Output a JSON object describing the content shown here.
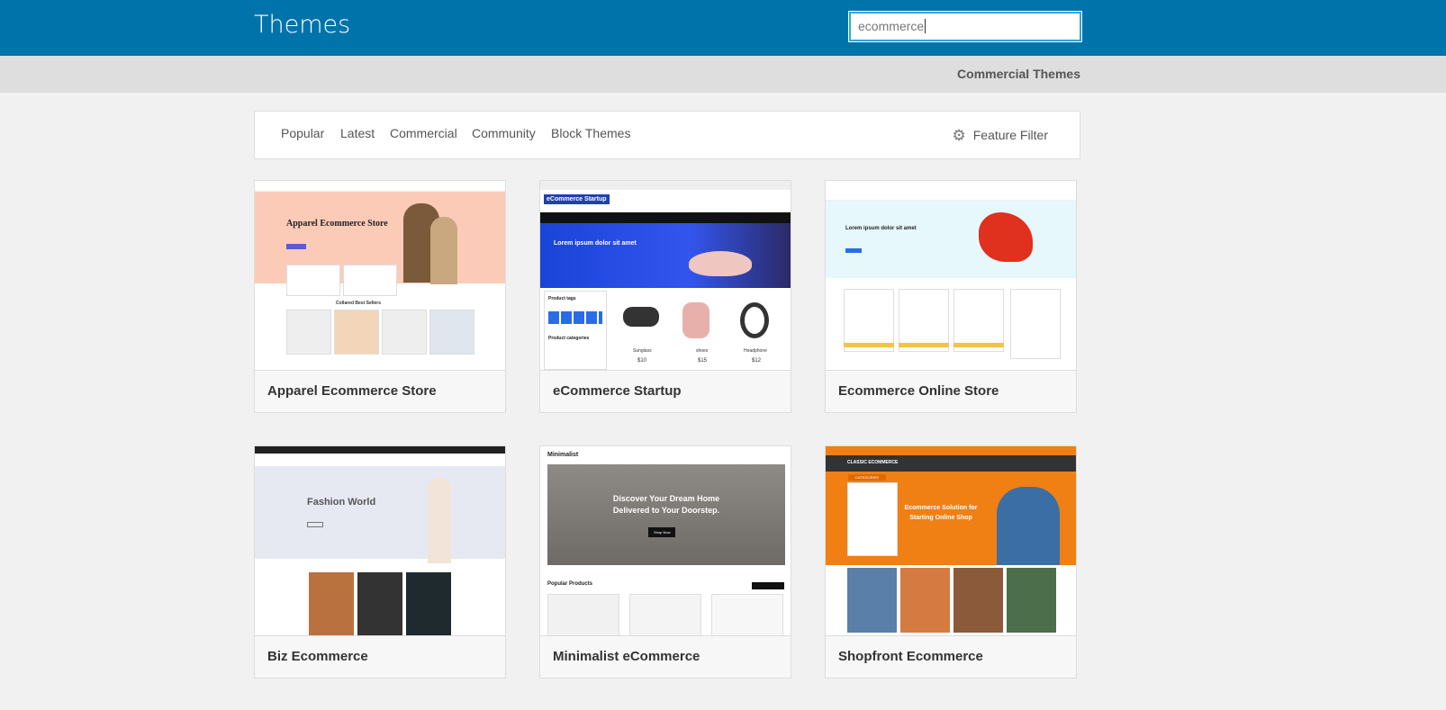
{
  "header": {
    "title": "Themes",
    "search_value": "ecommerce",
    "brand_color": "#0073aa"
  },
  "subbar": {
    "link": "Commercial Themes"
  },
  "filter": {
    "tabs": [
      "Popular",
      "Latest",
      "Commercial",
      "Community",
      "Block Themes"
    ],
    "feature_filter": "Feature Filter",
    "feature_icon": "gear-icon"
  },
  "themes": [
    {
      "name": "Apparel Ecommerce Store",
      "thumb_heading": "Apparel Ecommerce Store",
      "thumb_sub": "Collared Best Sellers"
    },
    {
      "name": "eCommerce Startup",
      "thumb_logo": "eCommerce Startup",
      "thumb_heading": "Lorem ipsum dolor sit amet",
      "thumb_side": "Product tags",
      "thumb_side2": "Product categories",
      "products": [
        {
          "name": "Sunglass",
          "price": "$10"
        },
        {
          "name": "shoes",
          "price": "$15"
        },
        {
          "name": "Headphone",
          "price": "$12"
        }
      ]
    },
    {
      "name": "Ecommerce Online Store",
      "thumb_heading": "Lorem ipsum dolor sit amet"
    },
    {
      "name": "Biz Ecommerce",
      "thumb_heading": "Fashion World"
    },
    {
      "name": "Minimalist eCommerce",
      "thumb_logo": "Minimalist",
      "thumb_heading": "Discover Your Dream Home Delivered to Your Doorstep.",
      "thumb_button": "Shop Now",
      "thumb_sub": "Popular Products"
    },
    {
      "name": "Shopfront Ecommerce",
      "thumb_logo": "CLASSIC ECOMMERCE",
      "thumb_heading": "Ecommerce Solution for Starting Online Shop",
      "thumb_side": "CATEGORIES"
    }
  ]
}
